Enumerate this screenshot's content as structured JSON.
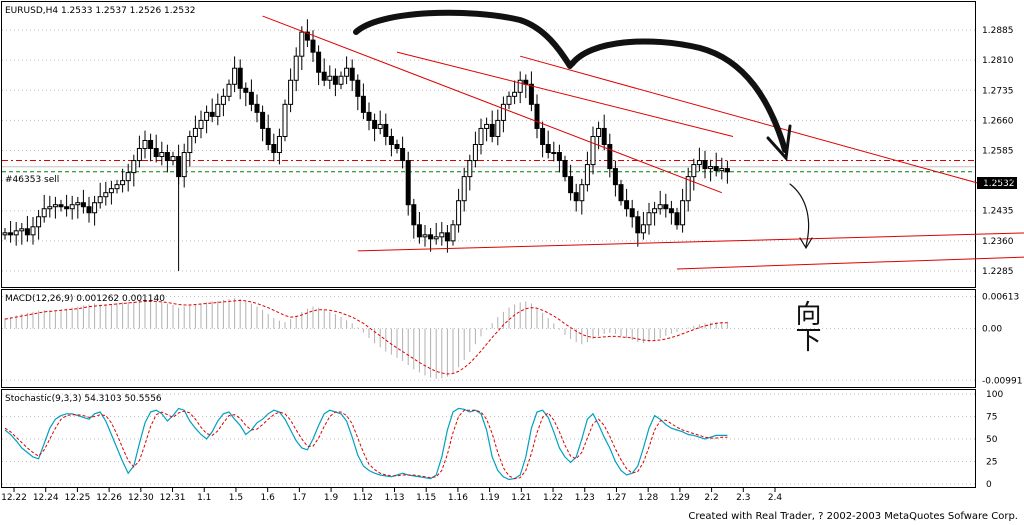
{
  "main_pane": {
    "title": "EURUSD,H4  1.2533 1.2537 1.2526 1.2532",
    "order_label": "#46353 sell",
    "current_price": "1.2532",
    "y_ticks": [
      "1.2885",
      "1.2810",
      "1.2735",
      "1.2660",
      "1.2585",
      "1.2510",
      "1.2435",
      "1.2360",
      "1.2285"
    ]
  },
  "macd_pane": {
    "title": "MACD(12,26,9)  0.001262  0.001140",
    "y_ticks": [
      "0.00613",
      "0.00",
      "-0.00991"
    ]
  },
  "stoch_pane": {
    "title": "Stochastic(9,3,3)  54.3103  50.5556",
    "y_ticks": [
      "100",
      "75",
      "50",
      "25",
      "0"
    ]
  },
  "x_ticks": [
    "12.22",
    "12.24",
    "12.25",
    "12.26",
    "12.30",
    "12.31",
    "1.1",
    "1.5",
    "1.6",
    "1.7",
    "1.9",
    "1.12",
    "1.13",
    "1.15",
    "1.16",
    "1.19",
    "1.21",
    "1.22",
    "1.23",
    "1.27",
    "1.28",
    "1.29",
    "2.2",
    "2.3",
    "2.4"
  ],
  "footer": "Created with Real Trader, ? 2002-2003 MetaQuotes Sofware Corp.",
  "annotation_text": "向下",
  "colors": {
    "bull_wick": "#000000",
    "trendline": "#e00000",
    "order_line": "#008000",
    "dash_level": "#e00000",
    "macd_hist": "#b0b0b0",
    "macd_signal": "#e00000",
    "stoch_main": "#00a0c0",
    "stoch_signal": "#e00000"
  },
  "chart_data": [
    {
      "type": "candlestick",
      "title": "EURUSD,H4",
      "ylim": [
        1.225,
        1.295
      ],
      "close_path": [
        [
          0,
          1.238
        ],
        [
          1,
          1.2375
        ],
        [
          2,
          1.2385
        ],
        [
          3,
          1.239
        ],
        [
          4,
          1.2375
        ],
        [
          5,
          1.2395
        ],
        [
          6,
          1.242
        ],
        [
          7,
          1.244
        ],
        [
          8,
          1.2445
        ],
        [
          9,
          1.245
        ],
        [
          10,
          1.2445
        ],
        [
          11,
          1.244
        ],
        [
          12,
          1.245
        ],
        [
          13,
          1.2455
        ],
        [
          14,
          1.2445
        ],
        [
          15,
          1.243
        ],
        [
          16,
          1.2455
        ],
        [
          17,
          1.247
        ],
        [
          18,
          1.248
        ],
        [
          19,
          1.249
        ],
        [
          20,
          1.25
        ],
        [
          21,
          1.251
        ],
        [
          22,
          1.253
        ],
        [
          23,
          1.256
        ],
        [
          24,
          1.259
        ],
        [
          25,
          1.261
        ],
        [
          26,
          1.259
        ],
        [
          27,
          1.257
        ],
        [
          28,
          1.258
        ],
        [
          29,
          1.256
        ],
        [
          30,
          1.257
        ],
        [
          31,
          1.252
        ],
        [
          32,
          1.258
        ],
        [
          33,
          1.262
        ],
        [
          34,
          1.264
        ],
        [
          35,
          1.266
        ],
        [
          36,
          1.268
        ],
        [
          37,
          1.267
        ],
        [
          38,
          1.27
        ],
        [
          39,
          1.272
        ],
        [
          40,
          1.275
        ],
        [
          41,
          1.279
        ],
        [
          42,
          1.274
        ],
        [
          43,
          1.273
        ],
        [
          44,
          1.27
        ],
        [
          45,
          1.268
        ],
        [
          46,
          1.264
        ],
        [
          47,
          1.26
        ],
        [
          48,
          1.258
        ],
        [
          49,
          1.262
        ],
        [
          50,
          1.27
        ],
        [
          51,
          1.276
        ],
        [
          52,
          1.282
        ],
        [
          53,
          1.288
        ],
        [
          54,
          1.286
        ],
        [
          55,
          1.283
        ],
        [
          56,
          1.278
        ],
        [
          57,
          1.276
        ],
        [
          58,
          1.277
        ],
        [
          59,
          1.275
        ],
        [
          60,
          1.277
        ],
        [
          61,
          1.279
        ],
        [
          62,
          1.276
        ],
        [
          63,
          1.272
        ],
        [
          64,
          1.268
        ],
        [
          65,
          1.266
        ],
        [
          66,
          1.264
        ],
        [
          67,
          1.265
        ],
        [
          68,
          1.262
        ],
        [
          69,
          1.26
        ],
        [
          70,
          1.259
        ],
        [
          71,
          1.256
        ],
        [
          72,
          1.245
        ],
        [
          73,
          1.24
        ],
        [
          74,
          1.237
        ],
        [
          75,
          1.2375
        ],
        [
          76,
          1.2365
        ],
        [
          77,
          1.237
        ],
        [
          78,
          1.238
        ],
        [
          79,
          1.236
        ],
        [
          80,
          1.24
        ],
        [
          81,
          1.246
        ],
        [
          82,
          1.252
        ],
        [
          83,
          1.256
        ],
        [
          84,
          1.26
        ],
        [
          85,
          1.264
        ],
        [
          86,
          1.265
        ],
        [
          87,
          1.262
        ],
        [
          88,
          1.266
        ],
        [
          89,
          1.27
        ],
        [
          90,
          1.272
        ],
        [
          91,
          1.273
        ],
        [
          92,
          1.276
        ],
        [
          93,
          1.275
        ],
        [
          94,
          1.27
        ],
        [
          95,
          1.264
        ],
        [
          96,
          1.26
        ],
        [
          97,
          1.258
        ],
        [
          98,
          1.258
        ],
        [
          99,
          1.256
        ],
        [
          100,
          1.252
        ],
        [
          101,
          1.248
        ],
        [
          102,
          1.246
        ],
        [
          103,
          1.25
        ],
        [
          104,
          1.255
        ],
        [
          105,
          1.262
        ],
        [
          106,
          1.264
        ],
        [
          107,
          1.26
        ],
        [
          108,
          1.254
        ],
        [
          109,
          1.25
        ],
        [
          110,
          1.246
        ],
        [
          111,
          1.244
        ],
        [
          112,
          1.242
        ],
        [
          113,
          1.238
        ],
        [
          114,
          1.24
        ],
        [
          115,
          1.243
        ],
        [
          116,
          1.244
        ],
        [
          117,
          1.245
        ],
        [
          118,
          1.244
        ],
        [
          119,
          1.243
        ],
        [
          120,
          1.24
        ],
        [
          121,
          1.246
        ],
        [
          122,
          1.252
        ],
        [
          123,
          1.255
        ],
        [
          124,
          1.256
        ],
        [
          125,
          1.254
        ],
        [
          126,
          1.2545
        ],
        [
          127,
          1.2535
        ],
        [
          128,
          1.254
        ],
        [
          129,
          1.2532
        ]
      ],
      "trendlines": [
        {
          "from": [
            46,
            1.292
          ],
          "to": [
            128,
            1.248
          ]
        },
        {
          "from": [
            70,
            1.283
          ],
          "to": [
            130,
            1.262
          ]
        },
        {
          "from": [
            92,
            1.282
          ],
          "to": [
            176,
            1.2495
          ]
        },
        {
          "from": [
            63,
            1.2335
          ],
          "to": [
            183,
            1.238
          ]
        },
        {
          "from": [
            120,
            1.229
          ],
          "to": [
            183,
            1.232
          ]
        }
      ],
      "order_price": 1.2532,
      "dash_price": 1.256
    },
    {
      "type": "bar",
      "title": "MACD(12,26,9)",
      "series": [
        {
          "name": "MACD",
          "kind": "histogram",
          "values": [
            0.002,
            0.0022,
            0.0025,
            0.0028,
            0.003,
            0.0032,
            0.0034,
            0.0035,
            0.0035,
            0.0034,
            0.0036,
            0.0038,
            0.004,
            0.0042,
            0.0044,
            0.0046,
            0.0048,
            0.0046,
            0.0045,
            0.0047,
            0.0049,
            0.005,
            0.0051,
            0.0052,
            0.0054,
            0.0055,
            0.0054,
            0.0052,
            0.005,
            0.0048,
            0.0045,
            0.004,
            0.0042,
            0.0044,
            0.0046,
            0.0048,
            0.005,
            0.0052,
            0.0053,
            0.0055,
            0.0056,
            0.0058,
            0.0056,
            0.0052,
            0.0048,
            0.0042,
            0.0036,
            0.0028,
            0.002,
            0.0015,
            0.0012,
            0.0018,
            0.0025,
            0.0032,
            0.0038,
            0.0042,
            0.004,
            0.0036,
            0.0032,
            0.0028,
            0.0022,
            0.0016,
            0.001,
            0.0002,
            -0.0008,
            -0.0018,
            -0.0028,
            -0.0036,
            -0.0044,
            -0.005,
            -0.0056,
            -0.0062,
            -0.007,
            -0.0078,
            -0.0084,
            -0.009,
            -0.0094,
            -0.0096,
            -0.0095,
            -0.0092,
            -0.0085,
            -0.0074,
            -0.006,
            -0.0045,
            -0.003,
            -0.0015,
            -0.0002,
            0.001,
            0.0022,
            0.0032,
            0.004,
            0.0046,
            0.005,
            0.0052,
            0.0048,
            0.004,
            0.003,
            0.002,
            0.001,
            -0.0002,
            -0.0012,
            -0.002,
            -0.0026,
            -0.003,
            -0.0026,
            -0.002,
            -0.0014,
            -0.001,
            -0.0008,
            -0.001,
            -0.0014,
            -0.0018,
            -0.0022,
            -0.0026,
            -0.0028,
            -0.0026,
            -0.0022,
            -0.0018,
            -0.0014,
            -0.001,
            -0.0006,
            -0.0002,
            0.0002,
            0.0005,
            0.0008,
            0.001,
            0.0011,
            0.0012,
            0.0012,
            0.0013
          ]
        },
        {
          "name": "Signal",
          "kind": "line",
          "values": [
            0.0018,
            0.002,
            0.0022,
            0.0024,
            0.0026,
            0.0028,
            0.003,
            0.0032,
            0.0033,
            0.0034,
            0.0035,
            0.0036,
            0.0037,
            0.0038,
            0.004,
            0.0042,
            0.0043,
            0.0044,
            0.0045,
            0.0046,
            0.0047,
            0.0048,
            0.0049,
            0.005,
            0.0051,
            0.0052,
            0.0052,
            0.0052,
            0.0051,
            0.005,
            0.0048,
            0.0046,
            0.0045,
            0.0045,
            0.0046,
            0.0047,
            0.0048,
            0.0049,
            0.005,
            0.0051,
            0.0052,
            0.0053,
            0.0054,
            0.0053,
            0.0051,
            0.0048,
            0.0044,
            0.004,
            0.0035,
            0.003,
            0.0025,
            0.0022,
            0.0023,
            0.0026,
            0.003,
            0.0034,
            0.0036,
            0.0036,
            0.0035,
            0.0033,
            0.003,
            0.0026,
            0.0022,
            0.0016,
            0.001,
            0.0002,
            -0.0006,
            -0.0014,
            -0.0022,
            -0.003,
            -0.0037,
            -0.0044,
            -0.0051,
            -0.0058,
            -0.0065,
            -0.0071,
            -0.0077,
            -0.0082,
            -0.0085,
            -0.0087,
            -0.0086,
            -0.0082,
            -0.0075,
            -0.0066,
            -0.0055,
            -0.0043,
            -0.003,
            -0.0017,
            -0.0005,
            0.0007,
            0.0017,
            0.0026,
            0.0033,
            0.0038,
            0.004,
            0.0039,
            0.0035,
            0.003,
            0.0024,
            0.0017,
            0.0009,
            0.0002,
            -0.0005,
            -0.0011,
            -0.0015,
            -0.0017,
            -0.0017,
            -0.0016,
            -0.0015,
            -0.0015,
            -0.0016,
            -0.0017,
            -0.0018,
            -0.002,
            -0.0022,
            -0.0023,
            -0.0023,
            -0.0022,
            -0.002,
            -0.0017,
            -0.0014,
            -0.001,
            -0.0006,
            -0.0002,
            0.0002,
            0.0005,
            0.0008,
            0.001,
            0.0011,
            0.0011
          ]
        }
      ],
      "ylim": [
        -0.011,
        0.007
      ]
    },
    {
      "type": "line",
      "title": "Stochastic(9,3,3)",
      "ylim": [
        0,
        100
      ],
      "series": [
        {
          "name": "Main",
          "values": [
            60,
            55,
            48,
            40,
            35,
            30,
            28,
            45,
            62,
            72,
            76,
            78,
            78,
            76,
            74,
            72,
            78,
            80,
            70,
            55,
            40,
            25,
            12,
            20,
            45,
            68,
            80,
            82,
            78,
            70,
            76,
            84,
            82,
            70,
            62,
            55,
            50,
            58,
            70,
            78,
            80,
            72,
            65,
            55,
            60,
            68,
            72,
            78,
            82,
            80,
            72,
            60,
            48,
            40,
            38,
            50,
            65,
            78,
            82,
            80,
            78,
            70,
            52,
            32,
            20,
            15,
            12,
            10,
            9,
            8,
            10,
            12,
            10,
            9,
            8,
            7,
            6,
            10,
            30,
            60,
            80,
            84,
            83,
            80,
            82,
            78,
            60,
            30,
            15,
            8,
            5,
            6,
            10,
            30,
            62,
            80,
            82,
            74,
            58,
            40,
            30,
            24,
            30,
            50,
            72,
            78,
            66,
            52,
            40,
            25,
            15,
            10,
            12,
            20,
            40,
            62,
            76,
            72,
            66,
            62,
            60,
            58,
            55,
            54,
            52,
            50,
            52,
            54,
            54,
            54
          ]
        },
        {
          "name": "Signal",
          "values": [
            62,
            58,
            52,
            46,
            40,
            35,
            31,
            38,
            50,
            62,
            72,
            76,
            77,
            77,
            76,
            74,
            75,
            77,
            76,
            68,
            55,
            40,
            26,
            19,
            26,
            44,
            64,
            77,
            80,
            77,
            74,
            79,
            81,
            79,
            72,
            63,
            56,
            54,
            59,
            68,
            76,
            77,
            73,
            65,
            60,
            61,
            66,
            72,
            77,
            80,
            78,
            71,
            60,
            50,
            42,
            42,
            51,
            64,
            75,
            80,
            80,
            76,
            67,
            51,
            35,
            22,
            16,
            12,
            10,
            9,
            9,
            10,
            10,
            10,
            9,
            8,
            7,
            8,
            15,
            33,
            57,
            75,
            82,
            82,
            82,
            80,
            72,
            56,
            35,
            18,
            9,
            6,
            7,
            15,
            34,
            57,
            74,
            79,
            71,
            58,
            43,
            31,
            28,
            35,
            51,
            67,
            72,
            65,
            53,
            39,
            27,
            17,
            12,
            14,
            24,
            41,
            60,
            70,
            71,
            67,
            63,
            60,
            58,
            56,
            54,
            52,
            51,
            51,
            52,
            52
          ]
        }
      ]
    }
  ]
}
